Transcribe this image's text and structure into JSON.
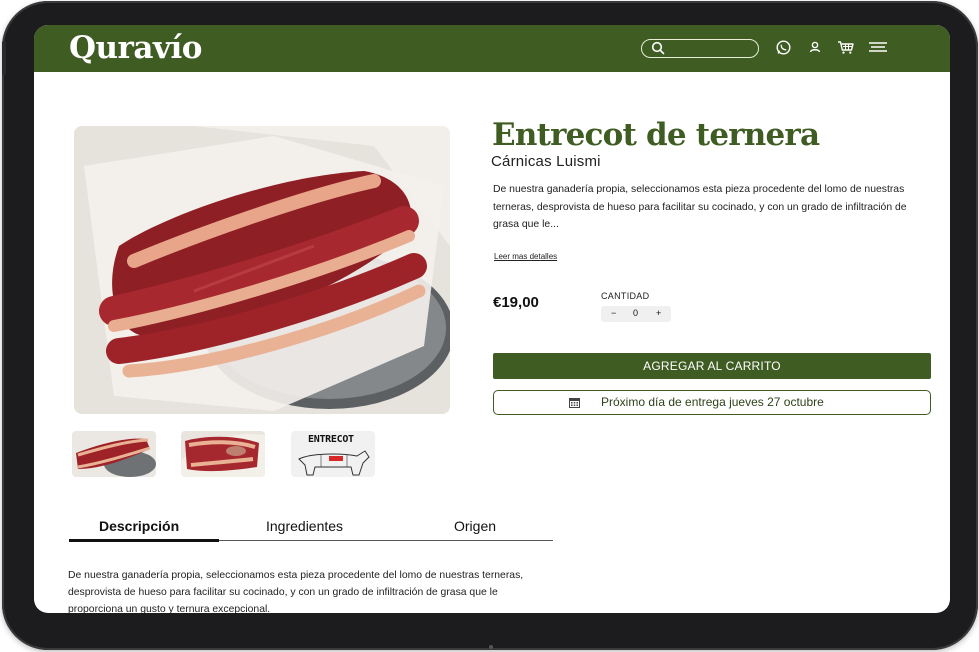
{
  "header": {
    "logo": "Quravío",
    "search": {
      "placeholder": ""
    },
    "icons": [
      "search-icon",
      "whatsapp-icon",
      "user-icon",
      "cart-icon",
      "menu-icon"
    ]
  },
  "product": {
    "title": "Entrecot de ternera",
    "brand": "Cárnicas Luismi",
    "description": "De nuestra ganadería propia, seleccionamos esta pieza procedente del lomo de nuestras terneras, desprovista de hueso para facilitar su cocinado, y con un grado de infiltración de grasa que le...",
    "read_more": "Leer mas detalles",
    "price": "€19,00",
    "quantity_label": "CANTIDAD",
    "quantity": "0",
    "minus": "−",
    "plus": "+",
    "add_to_cart": "AGREGAR AL CARRITO",
    "delivery": "Próximo día de entrega jueves 27 octubre",
    "thumb_label": "ENTRECOT"
  },
  "tabs": [
    {
      "label": "Descripción",
      "active": true
    },
    {
      "label": "Ingredientes",
      "active": false
    },
    {
      "label": "Origen",
      "active": false
    }
  ],
  "tab_content": "De nuestra ganadería propia, seleccionamos esta pieza procedente del lomo de nuestras terneras, desprovista de hueso para facilitar su cocinado, y con un grado de infiltración de grasa que le proporciona un gusto y ternura excepcional.",
  "colors": {
    "brand_green": "#3f5c23",
    "white": "#ffffff",
    "text": "#222222"
  }
}
